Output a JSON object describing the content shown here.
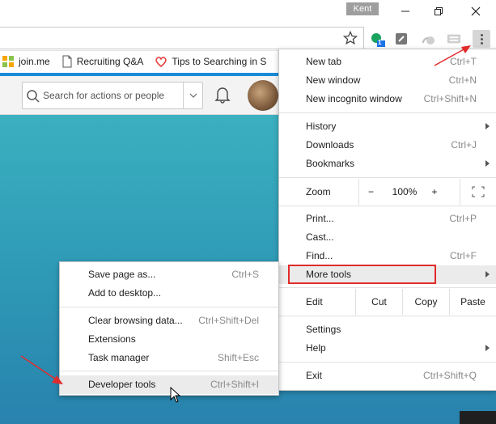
{
  "window": {
    "user_name": "Kent"
  },
  "bookmarks": [
    {
      "label": "join.me",
      "icon": "join-me-icon"
    },
    {
      "label": "Recruiting Q&A",
      "icon": "page-icon"
    },
    {
      "label": "Tips to Searching in S",
      "icon": "heart-icon"
    }
  ],
  "extensions": {
    "badge_count": "1"
  },
  "page": {
    "search_placeholder": "Search for actions or people"
  },
  "menu": {
    "new_tab": "New tab",
    "new_tab_sc": "Ctrl+T",
    "new_window": "New window",
    "new_window_sc": "Ctrl+N",
    "new_incognito": "New incognito window",
    "new_incognito_sc": "Ctrl+Shift+N",
    "history": "History",
    "downloads": "Downloads",
    "downloads_sc": "Ctrl+J",
    "bookmarks": "Bookmarks",
    "zoom": "Zoom",
    "zoom_minus": "−",
    "zoom_value": "100%",
    "zoom_plus": "+",
    "print": "Print...",
    "print_sc": "Ctrl+P",
    "cast": "Cast...",
    "find": "Find...",
    "find_sc": "Ctrl+F",
    "more_tools": "More tools",
    "edit": "Edit",
    "cut": "Cut",
    "copy": "Copy",
    "paste": "Paste",
    "settings": "Settings",
    "help": "Help",
    "exit": "Exit",
    "exit_sc": "Ctrl+Shift+Q"
  },
  "submenu": {
    "save_page": "Save page as...",
    "save_page_sc": "Ctrl+S",
    "add_desktop": "Add to desktop...",
    "clear_data": "Clear browsing data...",
    "clear_data_sc": "Ctrl+Shift+Del",
    "extensions": "Extensions",
    "task_manager": "Task manager",
    "task_manager_sc": "Shift+Esc",
    "dev_tools": "Developer tools",
    "dev_tools_sc": "Ctrl+Shift+I"
  },
  "colors": {
    "highlight_box": "#e22b2b",
    "annotation_arrow": "#e22b2b",
    "page_gradient_top": "#3bb0bf",
    "page_gradient_bottom": "#2882ad"
  }
}
